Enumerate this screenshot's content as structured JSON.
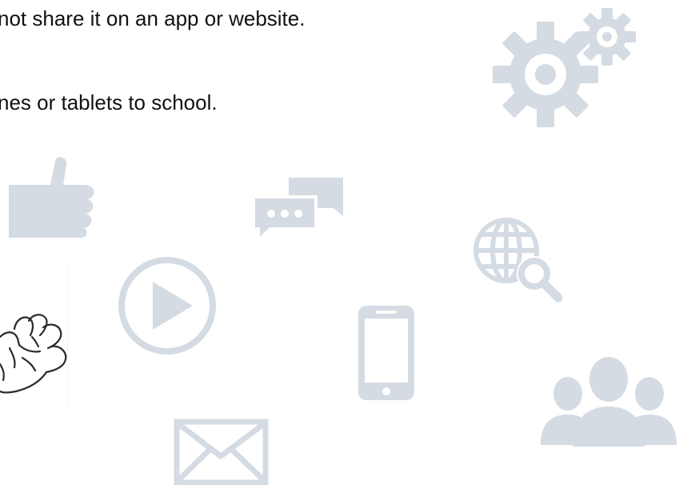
{
  "rules": [
    "not share it on an app or website.",
    "nes or tablets to school."
  ],
  "colors": {
    "text": "#111111",
    "icon": "#d4dbe3"
  },
  "icons": [
    "gears-icon",
    "thumbs-up-icon",
    "chat-bubbles-icon",
    "globe-search-icon",
    "play-button-icon",
    "smartphone-icon",
    "waving-hand-icon",
    "envelope-icon",
    "people-group-icon"
  ]
}
